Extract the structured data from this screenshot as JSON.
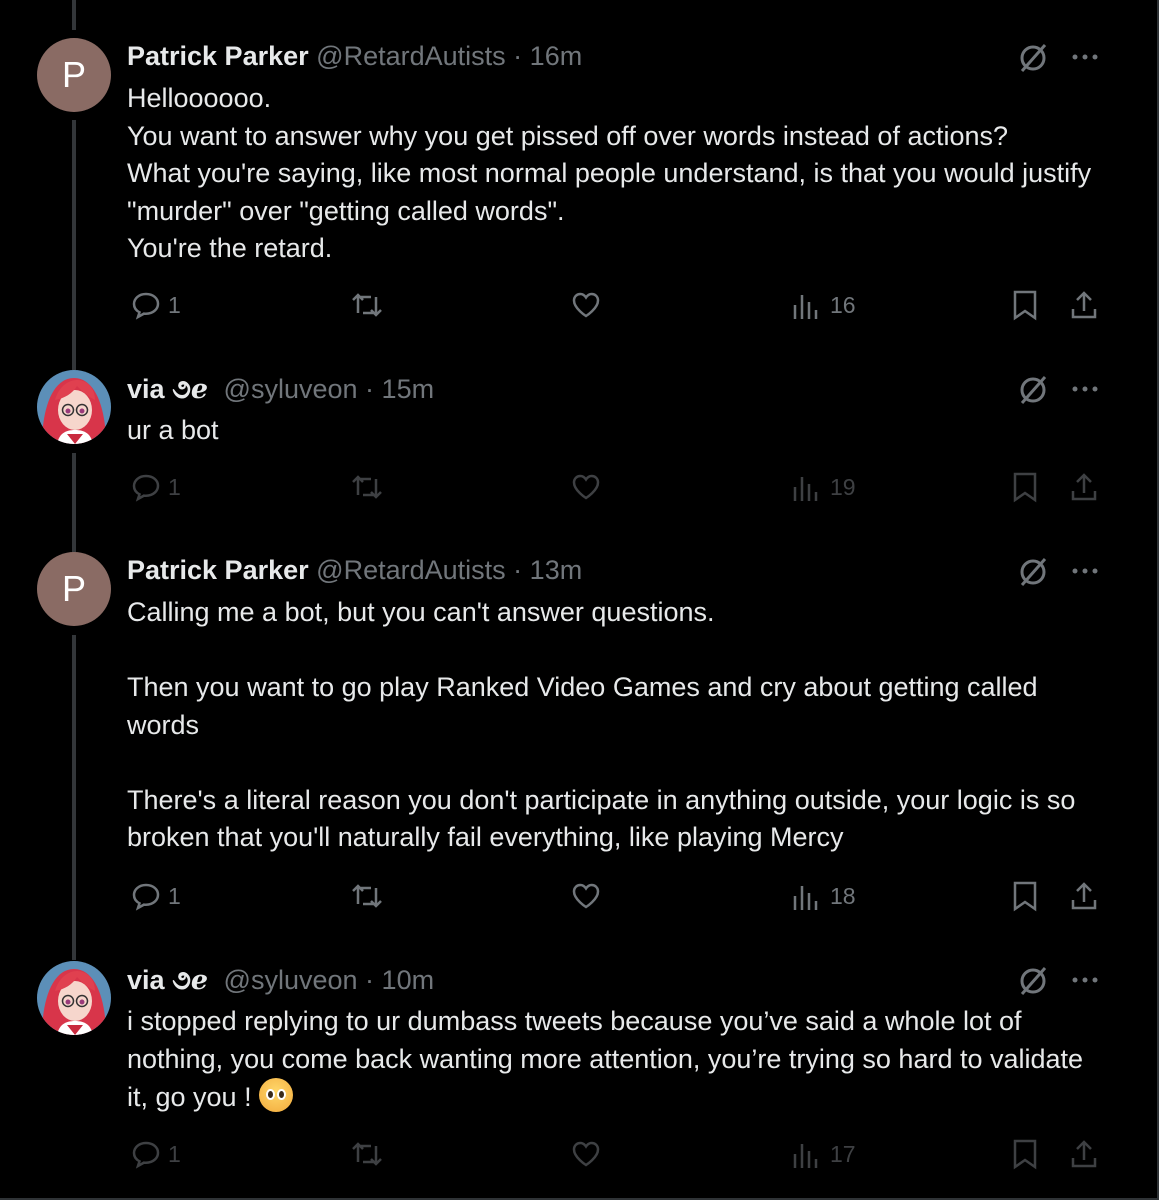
{
  "tweets": [
    {
      "avatar_letter": "P",
      "name": "Patrick Parker",
      "handle": "@RetardAutists",
      "time": "16m",
      "text": "Helloooooo.\nYou want to answer why you get pissed off over words instead of actions?\nWhat you're saying, like most normal people understand, is that you would justify \"murder\" over \"getting called words\".\nYou're the retard.",
      "replies": "1",
      "views": "16"
    },
    {
      "avatar_letter": "",
      "name": "via",
      "name_ornament": "૭ℯ",
      "handle": "@syluveon",
      "time": "15m",
      "text": "ur a bot",
      "replies": "1",
      "views": "19"
    },
    {
      "avatar_letter": "P",
      "name": "Patrick Parker",
      "handle": "@RetardAutists",
      "time": "13m",
      "text": "Calling me a bot, but you can't answer questions.\n\nThen you want to go play Ranked Video Games and cry about getting called words\n\nThere's a literal reason you don't participate in anything outside, your logic is so broken that you'll naturally fail everything, like playing Mercy",
      "replies": "1",
      "views": "18"
    },
    {
      "avatar_letter": "",
      "name": "via",
      "name_ornament": "૭ℯ",
      "handle": "@syluveon",
      "time": "10m",
      "text": "i stopped replying to ur dumbass tweets because you’ve said a whole lot of nothing, you come back wanting more attention, you’re trying so hard to validate it, go you ! ",
      "emoji": "pleading-face-emoji",
      "replies": "1",
      "views": "17"
    }
  ],
  "separator": "·",
  "colors": {
    "background": "#000000",
    "text": "#e7e9ea",
    "muted": "#71767b",
    "thread_line": "#333639"
  }
}
